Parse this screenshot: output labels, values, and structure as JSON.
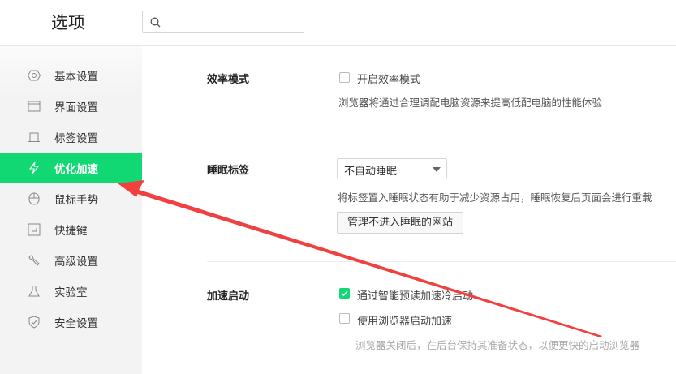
{
  "header": {
    "title": "选项",
    "search_placeholder": ""
  },
  "sidebar": {
    "items": [
      {
        "label": "基本设置",
        "icon": "hexagon-settings-icon"
      },
      {
        "label": "界面设置",
        "icon": "window-icon"
      },
      {
        "label": "标签设置",
        "icon": "tab-icon"
      },
      {
        "label": "优化加速",
        "icon": "lightning-icon",
        "active": true
      },
      {
        "label": "鼠标手势",
        "icon": "mouse-icon"
      },
      {
        "label": "快捷键",
        "icon": "keyboard-shortcut-icon"
      },
      {
        "label": "高级设置",
        "icon": "wrench-icon"
      },
      {
        "label": "实验室",
        "icon": "flask-icon"
      },
      {
        "label": "安全设置",
        "icon": "shield-icon"
      }
    ]
  },
  "efficiency": {
    "label": "效率模式",
    "checkbox": "开启效率模式",
    "checked": false,
    "desc": "浏览器将通过合理调配电脑资源来提高低配电脑的性能体验"
  },
  "sleep": {
    "label": "睡眠标签",
    "select_value": "不自动睡眠",
    "desc": "将标签置入睡眠状态有助于减少资源占用，睡眠恢复后页面会进行重载",
    "button": "管理不进入睡眠的网站"
  },
  "startup": {
    "label": "加速启动",
    "option1": "通过智能预读加速冷启动",
    "option1_checked": true,
    "option2": "使用浏览器启动加速",
    "option2_checked": false,
    "desc": "浏览器关闭后，在后台保持其准备状态，以便更快的启动浏览器"
  },
  "colors": {
    "accent": "#12d873",
    "annotation": "#f04040"
  }
}
